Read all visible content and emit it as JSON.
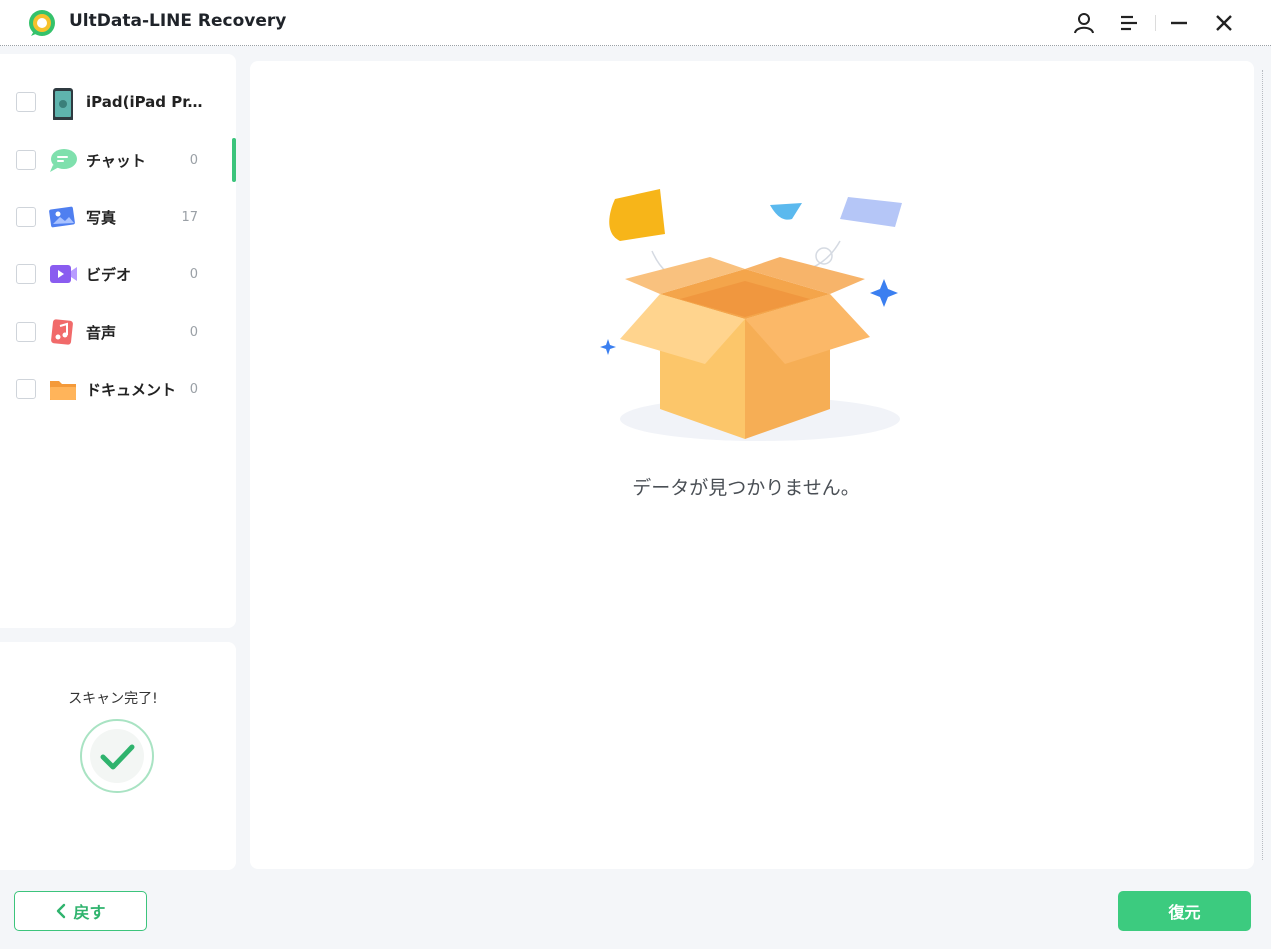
{
  "app": {
    "title": "UltData-LINE Recovery",
    "accent_color": "#3cc47c"
  },
  "titlebar": {
    "icons": [
      "user-icon",
      "menu-icon",
      "minimize-icon",
      "close-icon"
    ]
  },
  "sidebar": {
    "items": [
      {
        "label": "iPad(iPad Pr...",
        "count": "",
        "icon": "ipad-icon"
      },
      {
        "label": "チャット",
        "count": "0",
        "icon": "chat-icon"
      },
      {
        "label": "写真",
        "count": "17",
        "icon": "photo-icon"
      },
      {
        "label": "ビデオ",
        "count": "0",
        "icon": "video-icon"
      },
      {
        "label": "音声",
        "count": "0",
        "icon": "audio-icon"
      },
      {
        "label": "ドキュメント",
        "count": "0",
        "icon": "document-icon"
      }
    ]
  },
  "scan": {
    "status": "スキャン完了!"
  },
  "main": {
    "empty_message": "データが見つかりません。"
  },
  "footer": {
    "back_label": "戻す",
    "restore_label": "復元"
  }
}
